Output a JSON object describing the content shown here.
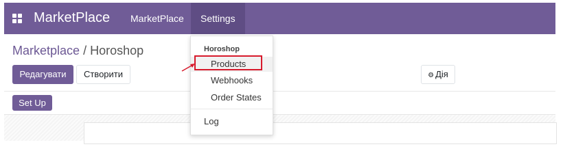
{
  "navbar": {
    "brand": "MarketPlace",
    "items": [
      {
        "label": "MarketPlace"
      },
      {
        "label": "Settings"
      }
    ]
  },
  "breadcrumb": {
    "parent": "Marketplace",
    "separator": "/",
    "current": "Horoshop"
  },
  "toolbar": {
    "edit_label": "Редагувати",
    "create_label": "Створити",
    "action_label": "Дія"
  },
  "setup_label": "Set Up",
  "dropdown": {
    "header": "Horoshop",
    "items": [
      "Products",
      "Webhooks",
      "Order States"
    ],
    "log_label": "Log"
  },
  "colors": {
    "brand": "#705c97",
    "highlight": "#d7192b"
  }
}
